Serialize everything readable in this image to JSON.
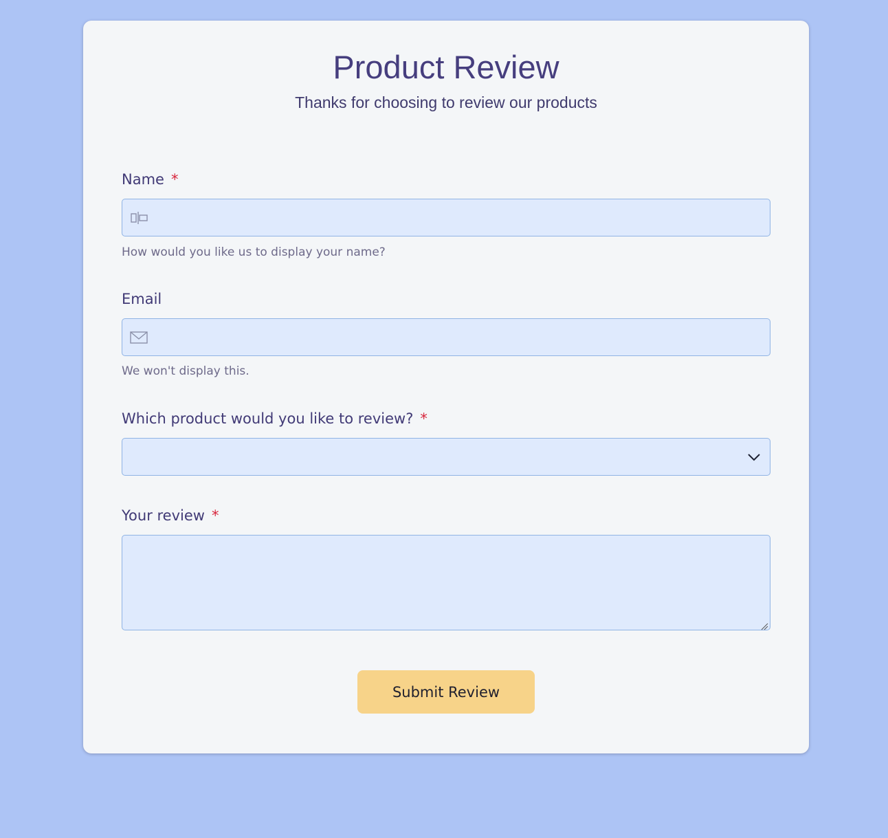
{
  "form": {
    "title": "Product Review",
    "subtitle": "Thanks for choosing to review our products",
    "required_marker": "*",
    "name": {
      "label": "Name",
      "value": "",
      "placeholder": "",
      "help": "How would you like us to display your name?",
      "icon": "id-card-icon"
    },
    "email": {
      "label": "Email",
      "value": "",
      "placeholder": "",
      "help": "We won't display this.",
      "icon": "envelope-icon"
    },
    "product": {
      "label": "Which product would you like to review?",
      "selected": "",
      "icon": "chevron-down-icon"
    },
    "review": {
      "label": "Your review",
      "value": ""
    },
    "submit_label": "Submit Review"
  },
  "colors": {
    "background": "#adc4f5",
    "card": "#f4f6f8",
    "title": "#463e7e",
    "field_bg": "#dfeafd",
    "field_border": "#8fb3e4",
    "required": "#d7263d",
    "button": "#f7d389"
  }
}
